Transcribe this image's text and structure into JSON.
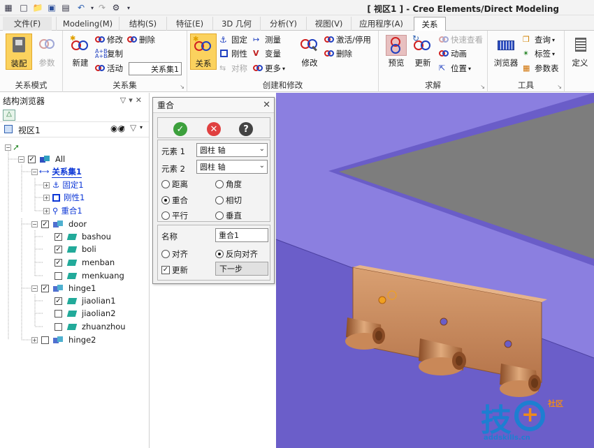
{
  "titlebar": {
    "title": "[ 视区1 ] - Creo Elements/Direct Modeling"
  },
  "tabs": [
    {
      "label": "文件(F)"
    },
    {
      "label": "Modeling(M)"
    },
    {
      "label": "结构(S)"
    },
    {
      "label": "特征(E)"
    },
    {
      "label": "3D 几何"
    },
    {
      "label": "分析(Y)"
    },
    {
      "label": "视图(V)"
    },
    {
      "label": "应用程序(A)"
    },
    {
      "label": "关系"
    }
  ],
  "ribbon": {
    "groups": {
      "mode": "关系模式",
      "relset": "关系集",
      "create": "创建和修改",
      "solve": "求解",
      "tools": "工具"
    },
    "assemble": "装配",
    "params": "参数",
    "new": "新建",
    "modify": "修改",
    "copy": "复制",
    "delete": "删除",
    "active": "活动",
    "relset_value": "关系集1",
    "relation": "关系",
    "fix": "固定",
    "rigid": "刚性",
    "symmetric": "对称",
    "measure": "测量",
    "variable": "变量",
    "more": "更多",
    "modify2": "修改",
    "activate": "激活/停用",
    "delete2": "删除",
    "preview": "预览",
    "update": "更新",
    "quickview": "快速查看",
    "animate": "动画",
    "position": "位置",
    "browser": "浏览器",
    "query": "查询",
    "label": "标签",
    "paramtable": "参数表",
    "define": "定义"
  },
  "browser": {
    "title": "结构浏览器",
    "view": "视区1",
    "tree": [
      {
        "label": "All"
      },
      {
        "label": "关系集1"
      },
      {
        "label": "固定1"
      },
      {
        "label": "刚性1"
      },
      {
        "label": "重合1"
      },
      {
        "label": "door"
      },
      {
        "label": "bashou"
      },
      {
        "label": "boli"
      },
      {
        "label": "menban"
      },
      {
        "label": "menkuang"
      },
      {
        "label": "hinge1"
      },
      {
        "label": "jiaolian1"
      },
      {
        "label": "jiaolian2"
      },
      {
        "label": "zhuanzhou"
      },
      {
        "label": "hinge2"
      }
    ]
  },
  "dialog": {
    "title": "重合",
    "element1_label": "元素 1",
    "element1_value": "圆柱 轴",
    "element2_label": "元素 2",
    "element2_value": "圆柱 轴",
    "options": [
      "距离",
      "角度",
      "重合",
      "相切",
      "平行",
      "垂直"
    ],
    "selected_option": "重合",
    "name_label": "名称",
    "name_value": "重合1",
    "align": "对齐",
    "reverse_align": "反向对齐",
    "update": "更新",
    "next": "下一步"
  },
  "watermark": {
    "text": "技",
    "badge": "社区",
    "url": "addskills.cn"
  }
}
